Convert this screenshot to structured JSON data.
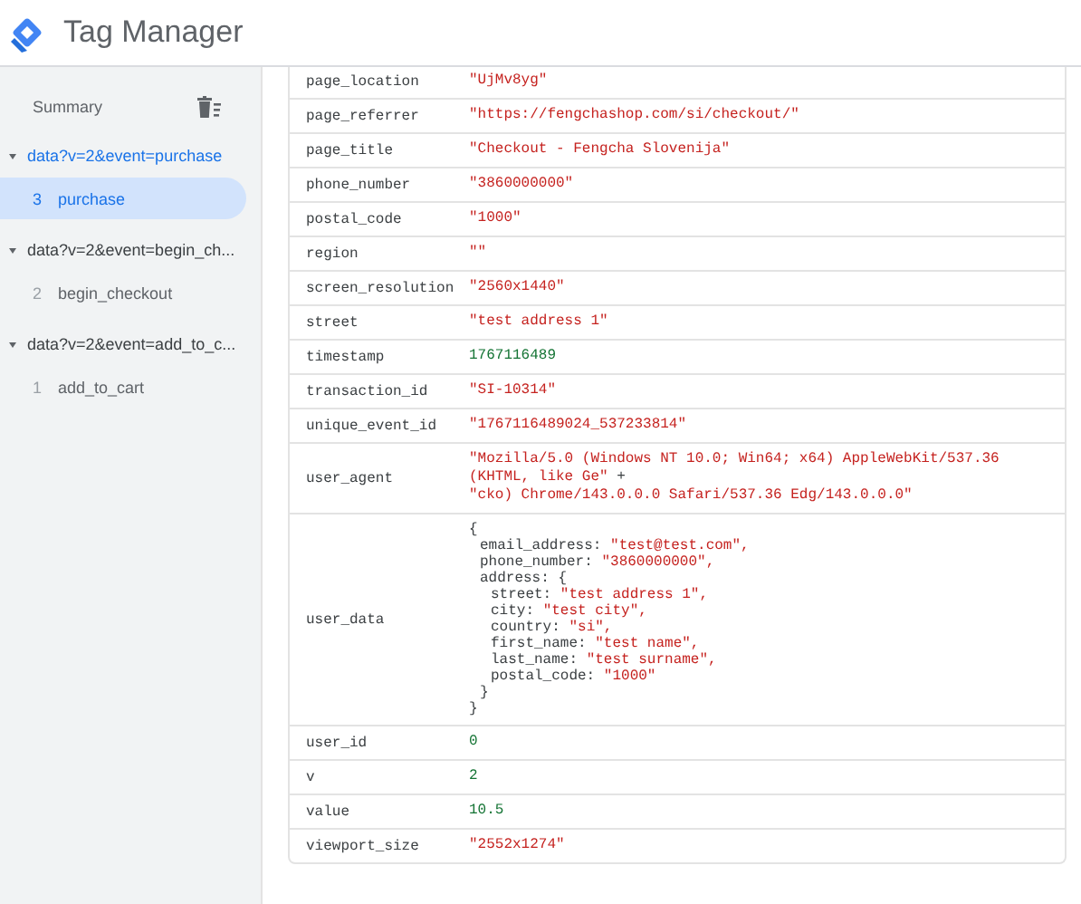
{
  "app": {
    "title": "Tag Manager"
  },
  "sidebar": {
    "summary": {
      "label": "Summary",
      "selected": false
    },
    "groups": [
      {
        "title": "data?v=2&event=purchase",
        "expanded": true,
        "selected": true,
        "items": [
          {
            "number": "3",
            "label": "purchase",
            "selected": true
          }
        ]
      },
      {
        "title": "data?v=2&event=begin_ch...",
        "expanded": true,
        "selected": false,
        "items": [
          {
            "number": "2",
            "label": "begin_checkout",
            "selected": false
          }
        ]
      },
      {
        "title": "data?v=2&event=add_to_c...",
        "expanded": true,
        "selected": false,
        "items": [
          {
            "number": "1",
            "label": "add_to_cart",
            "selected": false
          }
        ]
      }
    ]
  },
  "table": {
    "rows": [
      {
        "key": "page_location",
        "lines": [
          [
            {
              "text": "\"UjMv8yg\"",
              "kind": "string"
            }
          ]
        ]
      },
      {
        "key": "page_referrer",
        "lines": [
          [
            {
              "text": "\"https://fengchashop.com/si/checkout/\"",
              "kind": "string"
            }
          ]
        ]
      },
      {
        "key": "page_title",
        "lines": [
          [
            {
              "text": "\"Checkout - Fengcha Slovenija\"",
              "kind": "string"
            }
          ]
        ]
      },
      {
        "key": "phone_number",
        "lines": [
          [
            {
              "text": "\"3860000000\"",
              "kind": "string"
            }
          ]
        ]
      },
      {
        "key": "postal_code",
        "lines": [
          [
            {
              "text": "\"1000\"",
              "kind": "string"
            }
          ]
        ]
      },
      {
        "key": "region",
        "lines": [
          [
            {
              "text": "\"\"",
              "kind": "string"
            }
          ]
        ]
      },
      {
        "key": "screen_resolution",
        "lines": [
          [
            {
              "text": "\"2560x1440\"",
              "kind": "string"
            }
          ]
        ]
      },
      {
        "key": "street",
        "lines": [
          [
            {
              "text": "\"test address 1\"",
              "kind": "string"
            }
          ]
        ]
      },
      {
        "key": "timestamp",
        "lines": [
          [
            {
              "text": "1767116489",
              "kind": "number"
            }
          ]
        ]
      },
      {
        "key": "transaction_id",
        "lines": [
          [
            {
              "text": "\"SI-10314\"",
              "kind": "string"
            }
          ]
        ]
      },
      {
        "key": "unique_event_id",
        "lines": [
          [
            {
              "text": "\"1767116489024_537233814\"",
              "kind": "string"
            }
          ]
        ]
      },
      {
        "key": "user_agent",
        "lines": [
          [
            {
              "text": "\"Mozilla/5.0 (Windows NT 10.0; Win64; x64) AppleWebKit/537.36 (KHTML, like Ge\"",
              "kind": "string"
            },
            {
              "text": "+",
              "kind": "plain"
            }
          ],
          [
            {
              "text": "\"cko) Chrome/143.0.0.0 Safari/537.36 Edg/143.0.0.0\"",
              "kind": "string"
            }
          ]
        ]
      },
      {
        "key": "user_data",
        "object": {
          "open": "{",
          "close": "}",
          "entries": [
            {
              "key": "email_address:",
              "value": "\"test@test.com\","
            },
            {
              "key": "phone_number:",
              "value": "\"3860000000\","
            },
            {
              "key": "address:",
              "object": {
                "open": "{",
                "close": "}",
                "entries": [
                  {
                    "key": "street:",
                    "value": "\"test address 1\","
                  },
                  {
                    "key": "city:",
                    "value": "\"test city\","
                  },
                  {
                    "key": "country:",
                    "value": "\"si\","
                  },
                  {
                    "key": "first_name:",
                    "value": "\"test name\","
                  },
                  {
                    "key": "last_name:",
                    "value": "\"test surname\","
                  },
                  {
                    "key": "postal_code:",
                    "value": "\"1000\""
                  }
                ]
              }
            }
          ]
        }
      },
      {
        "key": "user_id",
        "lines": [
          [
            {
              "text": "0",
              "kind": "number"
            }
          ]
        ]
      },
      {
        "key": "v",
        "lines": [
          [
            {
              "text": "2",
              "kind": "number"
            }
          ]
        ]
      },
      {
        "key": "value",
        "lines": [
          [
            {
              "text": "10.5",
              "kind": "number"
            }
          ]
        ]
      },
      {
        "key": "viewport_size",
        "lines": [
          [
            {
              "text": "\"2552x1274\"",
              "kind": "string"
            }
          ]
        ]
      }
    ]
  }
}
